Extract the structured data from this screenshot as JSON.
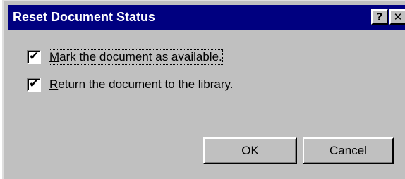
{
  "dialog": {
    "title": "Reset Document Status",
    "help_button": "?",
    "close_button": "✕"
  },
  "options": [
    {
      "label": "Mark the document as available.",
      "checked": true,
      "mnemonic": "M"
    },
    {
      "label": "Return the document to the library.",
      "checked": true,
      "mnemonic": "R"
    }
  ],
  "buttons": {
    "ok": "OK",
    "cancel": "Cancel"
  },
  "check_glyph": "✔",
  "colors": {
    "titlebar": "#000080",
    "face": "#c0c0c0"
  }
}
